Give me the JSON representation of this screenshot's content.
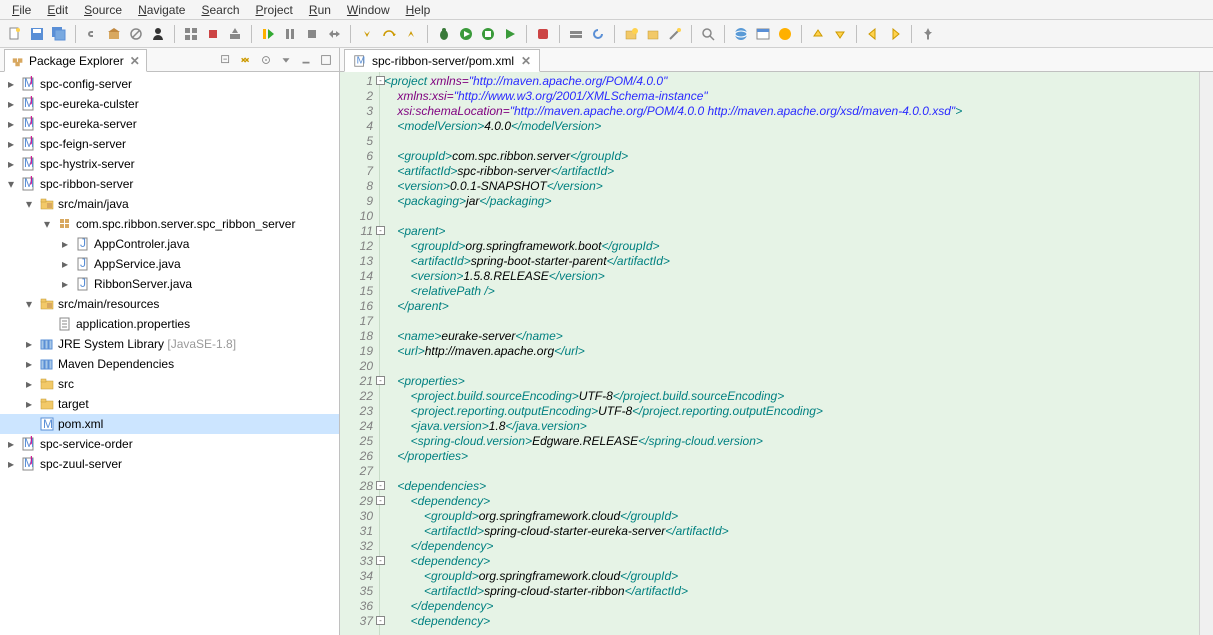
{
  "menu": [
    "File",
    "Edit",
    "Source",
    "Navigate",
    "Search",
    "Project",
    "Run",
    "Window",
    "Help"
  ],
  "explorer": {
    "title": "Package Explorer",
    "tree": [
      {
        "d": 0,
        "t": "c",
        "ic": "mvn",
        "lbl": "spc-config-server"
      },
      {
        "d": 0,
        "t": "c",
        "ic": "mvn",
        "lbl": "spc-eureka-culster"
      },
      {
        "d": 0,
        "t": "c",
        "ic": "mvn",
        "lbl": "spc-eureka-server"
      },
      {
        "d": 0,
        "t": "c",
        "ic": "mvn",
        "lbl": "spc-feign-server"
      },
      {
        "d": 0,
        "t": "c",
        "ic": "mvn",
        "lbl": "spc-hystrix-server"
      },
      {
        "d": 0,
        "t": "o",
        "ic": "mvn",
        "lbl": "spc-ribbon-server"
      },
      {
        "d": 1,
        "t": "o",
        "ic": "srcfolder",
        "lbl": "src/main/java"
      },
      {
        "d": 2,
        "t": "o",
        "ic": "pkg",
        "lbl": "com.spc.ribbon.server.spc_ribbon_server"
      },
      {
        "d": 3,
        "t": "c",
        "ic": "java",
        "lbl": "AppControler.java"
      },
      {
        "d": 3,
        "t": "c",
        "ic": "java",
        "lbl": "AppService.java"
      },
      {
        "d": 3,
        "t": "c",
        "ic": "java",
        "lbl": "RibbonServer.java"
      },
      {
        "d": 1,
        "t": "o",
        "ic": "srcfolder",
        "lbl": "src/main/resources"
      },
      {
        "d": 2,
        "t": "l",
        "ic": "file",
        "lbl": "application.properties"
      },
      {
        "d": 1,
        "t": "c",
        "ic": "lib",
        "lbl": "JRE System Library",
        "decor": " [JavaSE-1.8]"
      },
      {
        "d": 1,
        "t": "c",
        "ic": "lib",
        "lbl": "Maven Dependencies"
      },
      {
        "d": 1,
        "t": "c",
        "ic": "folder",
        "lbl": "src"
      },
      {
        "d": 1,
        "t": "c",
        "ic": "folder",
        "lbl": "target"
      },
      {
        "d": 1,
        "t": "l",
        "ic": "m",
        "lbl": "pom.xml",
        "sel": true
      },
      {
        "d": 0,
        "t": "c",
        "ic": "mvn",
        "lbl": "spc-service-order"
      },
      {
        "d": 0,
        "t": "c",
        "ic": "mvn",
        "lbl": "spc-zuul-server"
      }
    ]
  },
  "editor": {
    "tab_title": "spc-ribbon-server/pom.xml",
    "lines": [
      {
        "n": 1,
        "fold": "-",
        "seg": [
          [
            "tag",
            "<project "
          ],
          [
            "attr",
            "xmlns="
          ],
          [
            "str",
            "\"http://maven.apache.org/POM/4.0.0\""
          ]
        ]
      },
      {
        "n": 2,
        "seg": [
          [
            "",
            "    "
          ],
          [
            "attr",
            "xmlns:xsi="
          ],
          [
            "str",
            "\"http://www.w3.org/2001/XMLSchema-instance\""
          ]
        ]
      },
      {
        "n": 3,
        "seg": [
          [
            "",
            "    "
          ],
          [
            "attr",
            "xsi:schemaLocation="
          ],
          [
            "str",
            "\"http://maven.apache.org/POM/4.0.0 http://maven.apache.org/xsd/maven-4.0.0.xsd\""
          ],
          [
            "tag",
            ">"
          ]
        ]
      },
      {
        "n": 4,
        "seg": [
          [
            "",
            "    "
          ],
          [
            "tag",
            "<modelVersion>"
          ],
          [
            "txt",
            "4.0.0"
          ],
          [
            "tag",
            "</modelVersion>"
          ]
        ]
      },
      {
        "n": 5,
        "seg": []
      },
      {
        "n": 6,
        "seg": [
          [
            "",
            "    "
          ],
          [
            "tag",
            "<groupId>"
          ],
          [
            "txt",
            "com.spc.ribbon.server"
          ],
          [
            "tag",
            "</groupId>"
          ]
        ]
      },
      {
        "n": 7,
        "seg": [
          [
            "",
            "    "
          ],
          [
            "tag",
            "<artifactId>"
          ],
          [
            "txt",
            "spc-ribbon-server"
          ],
          [
            "tag",
            "</artifactId>"
          ]
        ]
      },
      {
        "n": 8,
        "seg": [
          [
            "",
            "    "
          ],
          [
            "tag",
            "<version>"
          ],
          [
            "txt",
            "0.0.1-SNAPSHOT"
          ],
          [
            "tag",
            "</version>"
          ]
        ]
      },
      {
        "n": 9,
        "seg": [
          [
            "",
            "    "
          ],
          [
            "tag",
            "<packaging>"
          ],
          [
            "txt",
            "jar"
          ],
          [
            "tag",
            "</packaging>"
          ]
        ]
      },
      {
        "n": 10,
        "seg": []
      },
      {
        "n": 11,
        "fold": "-",
        "seg": [
          [
            "",
            "    "
          ],
          [
            "tag",
            "<parent>"
          ]
        ]
      },
      {
        "n": 12,
        "seg": [
          [
            "",
            "        "
          ],
          [
            "tag",
            "<groupId>"
          ],
          [
            "txt",
            "org.springframework.boot"
          ],
          [
            "tag",
            "</groupId>"
          ]
        ]
      },
      {
        "n": 13,
        "seg": [
          [
            "",
            "        "
          ],
          [
            "tag",
            "<artifactId>"
          ],
          [
            "txt",
            "spring-boot-starter-parent"
          ],
          [
            "tag",
            "</artifactId>"
          ]
        ]
      },
      {
        "n": 14,
        "seg": [
          [
            "",
            "        "
          ],
          [
            "tag",
            "<version>"
          ],
          [
            "txt",
            "1.5.8.RELEASE"
          ],
          [
            "tag",
            "</version>"
          ]
        ]
      },
      {
        "n": 15,
        "seg": [
          [
            "",
            "        "
          ],
          [
            "tag",
            "<relativePath />"
          ]
        ]
      },
      {
        "n": 16,
        "seg": [
          [
            "",
            "    "
          ],
          [
            "tag",
            "</parent>"
          ]
        ]
      },
      {
        "n": 17,
        "seg": []
      },
      {
        "n": 18,
        "seg": [
          [
            "",
            "    "
          ],
          [
            "tag",
            "<name>"
          ],
          [
            "txt",
            "eurake-server"
          ],
          [
            "tag",
            "</name>"
          ]
        ]
      },
      {
        "n": 19,
        "seg": [
          [
            "",
            "    "
          ],
          [
            "tag",
            "<url>"
          ],
          [
            "txt",
            "http://maven.apache.org"
          ],
          [
            "tag",
            "</url>"
          ]
        ]
      },
      {
        "n": 20,
        "seg": []
      },
      {
        "n": 21,
        "fold": "-",
        "seg": [
          [
            "",
            "    "
          ],
          [
            "tag",
            "<properties>"
          ]
        ]
      },
      {
        "n": 22,
        "seg": [
          [
            "",
            "        "
          ],
          [
            "tag",
            "<project.build.sourceEncoding>"
          ],
          [
            "txt",
            "UTF-8"
          ],
          [
            "tag",
            "</project.build.sourceEncoding>"
          ]
        ]
      },
      {
        "n": 23,
        "seg": [
          [
            "",
            "        "
          ],
          [
            "tag",
            "<project.reporting.outputEncoding>"
          ],
          [
            "txt",
            "UTF-8"
          ],
          [
            "tag",
            "</project.reporting.outputEncoding>"
          ]
        ]
      },
      {
        "n": 24,
        "seg": [
          [
            "",
            "        "
          ],
          [
            "tag",
            "<java.version>"
          ],
          [
            "txt",
            "1.8"
          ],
          [
            "tag",
            "</java.version>"
          ]
        ]
      },
      {
        "n": 25,
        "seg": [
          [
            "",
            "        "
          ],
          [
            "tag",
            "<spring-cloud.version>"
          ],
          [
            "txt",
            "Edgware.RELEASE"
          ],
          [
            "tag",
            "</spring-cloud.version>"
          ]
        ]
      },
      {
        "n": 26,
        "seg": [
          [
            "",
            "    "
          ],
          [
            "tag",
            "</properties>"
          ]
        ]
      },
      {
        "n": 27,
        "seg": []
      },
      {
        "n": 28,
        "fold": "-",
        "seg": [
          [
            "",
            "    "
          ],
          [
            "tag",
            "<dependencies>"
          ]
        ]
      },
      {
        "n": 29,
        "fold": "-",
        "seg": [
          [
            "",
            "        "
          ],
          [
            "tag",
            "<dependency>"
          ]
        ]
      },
      {
        "n": 30,
        "seg": [
          [
            "",
            "            "
          ],
          [
            "tag",
            "<groupId>"
          ],
          [
            "txt",
            "org.springframework.cloud"
          ],
          [
            "tag",
            "</groupId>"
          ]
        ]
      },
      {
        "n": 31,
        "seg": [
          [
            "",
            "            "
          ],
          [
            "tag",
            "<artifactId>"
          ],
          [
            "txt",
            "spring-cloud-starter-eureka-server"
          ],
          [
            "tag",
            "</artifactId>"
          ]
        ]
      },
      {
        "n": 32,
        "seg": [
          [
            "",
            "        "
          ],
          [
            "tag",
            "</dependency>"
          ]
        ]
      },
      {
        "n": 33,
        "fold": "-",
        "seg": [
          [
            "",
            "        "
          ],
          [
            "tag",
            "<dependency>"
          ]
        ]
      },
      {
        "n": 34,
        "seg": [
          [
            "",
            "            "
          ],
          [
            "tag",
            "<groupId>"
          ],
          [
            "txt",
            "org.springframework.cloud"
          ],
          [
            "tag",
            "</groupId>"
          ]
        ]
      },
      {
        "n": 35,
        "seg": [
          [
            "",
            "            "
          ],
          [
            "tag",
            "<artifactId>"
          ],
          [
            "txt",
            "spring-cloud-starter-ribbon"
          ],
          [
            "tag",
            "</artifactId>"
          ]
        ]
      },
      {
        "n": 36,
        "seg": [
          [
            "",
            "        "
          ],
          [
            "tag",
            "</dependency>"
          ]
        ]
      },
      {
        "n": 37,
        "fold": "-",
        "seg": [
          [
            "",
            "        "
          ],
          [
            "tag",
            "<dependency>"
          ]
        ]
      }
    ]
  }
}
